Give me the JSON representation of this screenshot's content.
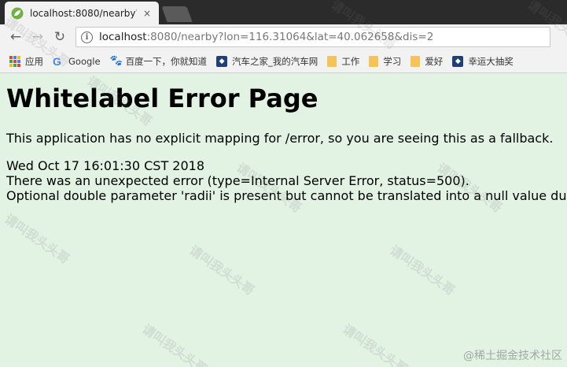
{
  "tab": {
    "title": "localhost:8080/nearby?",
    "close_glyph": "×"
  },
  "toolbar": {
    "back_glyph": "←",
    "forward_glyph": "→",
    "reload_glyph": "↻",
    "info_glyph": "i",
    "url_host": "localhost",
    "url_rest": ":8080/nearby?lon=116.31064&lat=40.062658&dis=2"
  },
  "bookmarks": [
    {
      "label": "应用",
      "icon": "apps-icon"
    },
    {
      "label": "Google",
      "icon": "google-icon"
    },
    {
      "label": "百度一下，你就知道",
      "icon": "baidu-paw-icon"
    },
    {
      "label": "汽车之家_我的汽车网",
      "icon": "autohome-icon"
    },
    {
      "label": "工作",
      "icon": "folder-icon"
    },
    {
      "label": "学习",
      "icon": "folder-icon"
    },
    {
      "label": "爱好",
      "icon": "folder-icon"
    },
    {
      "label": "幸运大抽奖",
      "icon": "site-icon"
    }
  ],
  "page": {
    "heading": "Whitelabel Error Page",
    "explanation": "This application has no explicit mapping for /error, so you are seeing this as a fallback.",
    "timestamp": "Wed Oct 17 16:01:30 CST 2018",
    "error_line": "There was an unexpected error (type=Internal Server Error, status=500).",
    "error_detail": "Optional double parameter 'radii' is present but cannot be translated into a null value due to"
  },
  "watermark": {
    "text": "请叫我头头哥",
    "corner": "@稀土掘金技术社区"
  },
  "colors": {
    "page_background": "#e2f2e3",
    "tab_strip": "#2b2b2b",
    "chrome": "#f2f2f2",
    "folder": "#f6c35b"
  }
}
